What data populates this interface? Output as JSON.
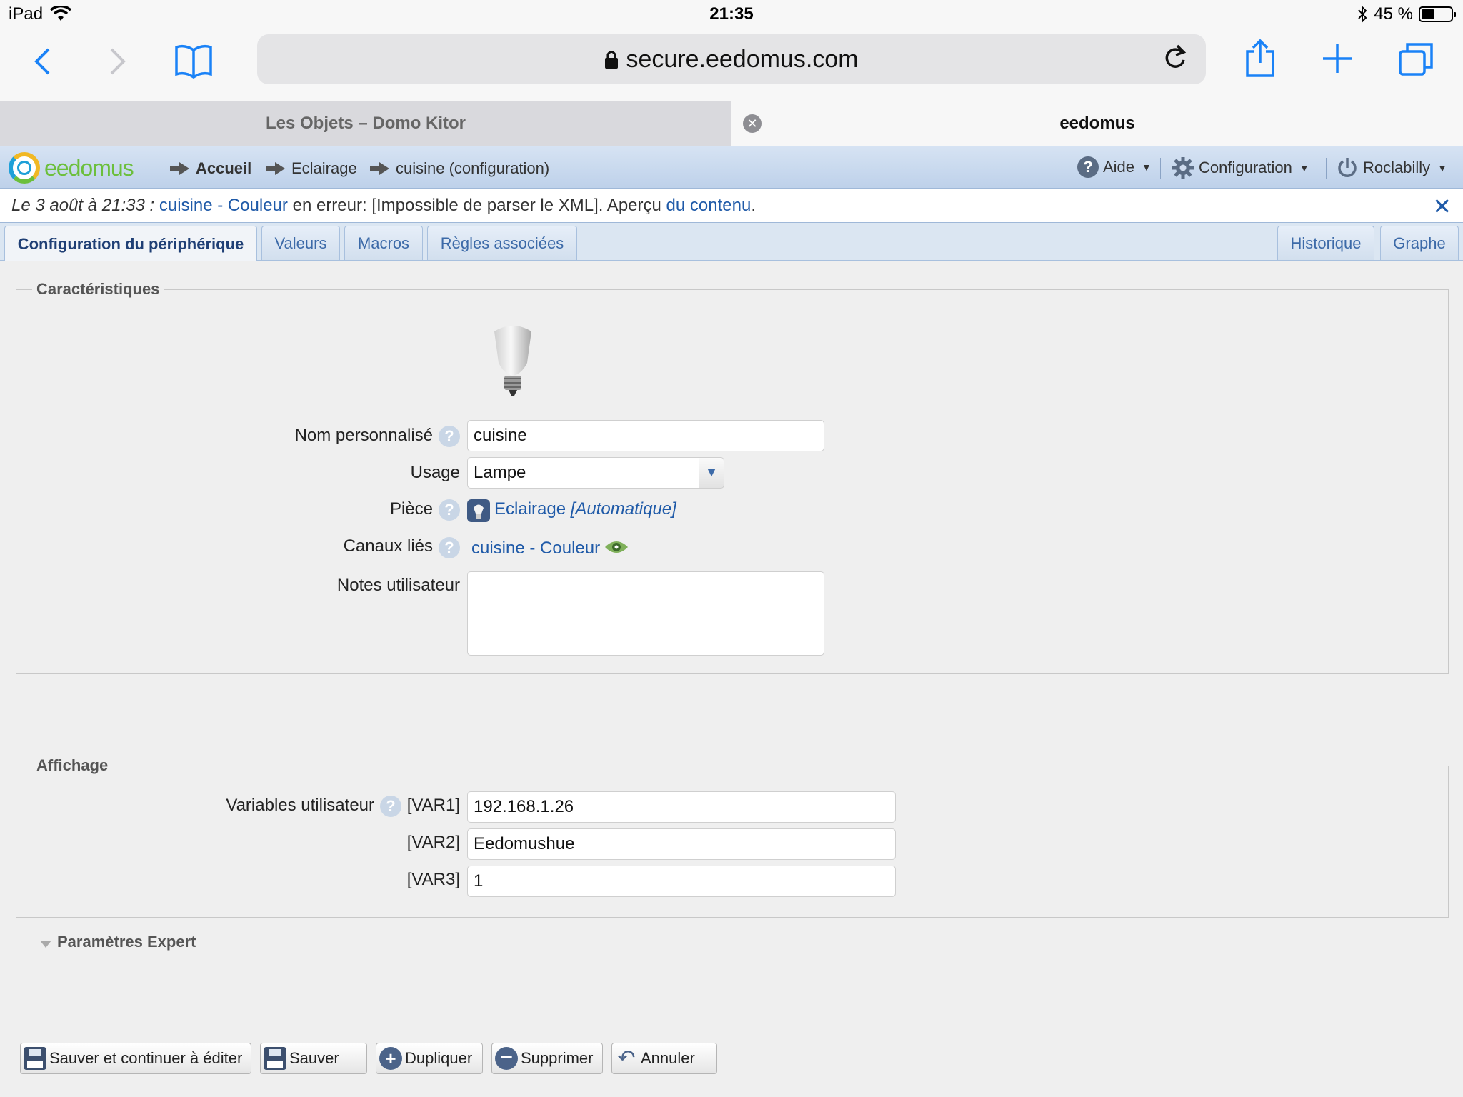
{
  "status": {
    "device": "iPad",
    "time": "21:35",
    "battery": "45 %",
    "battery_level": 0.45
  },
  "browser": {
    "url": "secure.eedomus.com",
    "tabs": [
      {
        "label": "Les Objets – Domo Kitor"
      },
      {
        "label": "eedomus"
      }
    ]
  },
  "nav": {
    "logo": "eedomus",
    "breadcrumb": [
      "Accueil",
      "Eclairage",
      "cuisine (configuration)"
    ],
    "aide": "Aide",
    "configuration": "Configuration",
    "user": "Roclabilly"
  },
  "error": {
    "date": "Le 3 août à 21:33 :",
    "device_link": "cuisine - Couleur",
    "text": " en erreur: [Impossible de parser le XML]. Aperçu ",
    "content_link": "du contenu",
    "end": "."
  },
  "tabs": [
    "Configuration du périphérique",
    "Valeurs",
    "Macros",
    "Règles associées",
    "Historique",
    "Graphe"
  ],
  "caracteristiques": {
    "legend": "Caractéristiques",
    "nom_label": "Nom personnalisé",
    "nom_value": "cuisine",
    "usage_label": "Usage",
    "usage_value": "Lampe",
    "piece_label": "Pièce",
    "piece_value": "Eclairage",
    "piece_auto": "[Automatique]",
    "canaux_label": "Canaux liés",
    "canaux_value": "cuisine - Couleur",
    "notes_label": "Notes utilisateur",
    "notes_value": ""
  },
  "affichage": {
    "legend": "Affichage",
    "variables_label": "Variables utilisateur",
    "vars": [
      {
        "label": "[VAR1]",
        "value": "192.168.1.26"
      },
      {
        "label": "[VAR2]",
        "value": "Eedomushue"
      },
      {
        "label": "[VAR3]",
        "value": "1"
      }
    ]
  },
  "expert": {
    "label": "Paramètres Expert"
  },
  "buttons": {
    "save_continue": "Sauver et continuer à éditer",
    "save": "Sauver",
    "duplicate": "Dupliquer",
    "delete": "Supprimer",
    "cancel": "Annuler"
  },
  "help_glyph": "?"
}
